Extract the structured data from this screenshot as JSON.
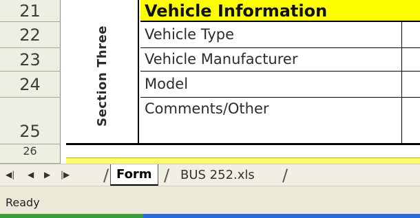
{
  "row_headers": [
    "21",
    "22",
    "23",
    "24",
    "25",
    "26"
  ],
  "section_label": "Section Three",
  "section_header": "Vehicle Information",
  "fields": [
    "Vehicle Type",
    "Vehicle Manufacturer",
    "Model",
    "Comments/Other"
  ],
  "sheet_tabs": [
    "Form",
    "BUS 252.xls"
  ],
  "tab_separator": "/",
  "status": {
    "text": "Ready"
  },
  "colors": {
    "header_yellow": "#ffff00",
    "tab_background": "#f1efe4",
    "status_background": "#ece9d8",
    "taskbar_green": "#3e9a3a",
    "taskbar_blue": "#2f67d9"
  },
  "icons": {
    "nav_first": "first-sheet-icon",
    "nav_prev": "prev-sheet-icon",
    "nav_next": "next-sheet-icon",
    "nav_last": "last-sheet-icon"
  }
}
